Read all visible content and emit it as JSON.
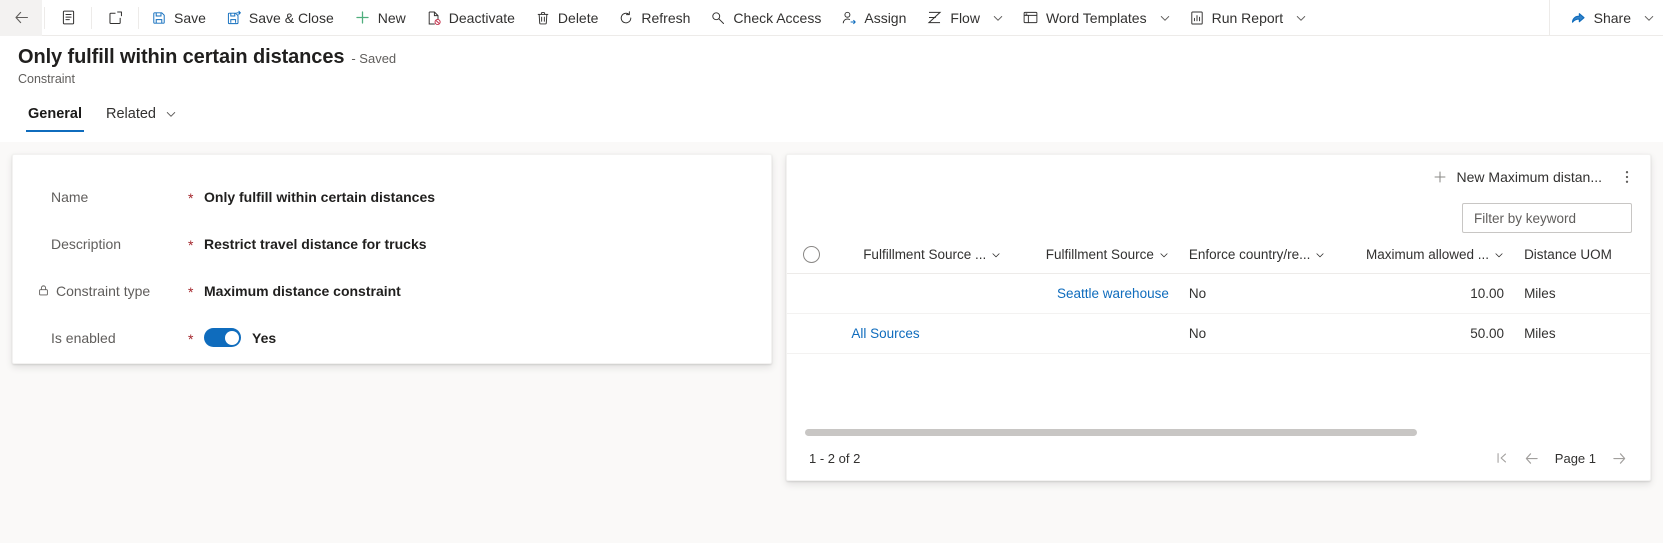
{
  "commandbar": {
    "back_icon": "back-arrow-icon",
    "form_selector_icon": "form-selector-icon",
    "popout_icon": "open-in-new-window-icon",
    "buttons": [
      {
        "label": "Save",
        "icon": "save-icon"
      },
      {
        "label": "Save & Close",
        "icon": "save-and-close-icon"
      },
      {
        "label": "New",
        "icon": "plus-icon"
      },
      {
        "label": "Deactivate",
        "icon": "deactivate-icon"
      },
      {
        "label": "Delete",
        "icon": "trash-icon"
      },
      {
        "label": "Refresh",
        "icon": "refresh-icon"
      },
      {
        "label": "Check Access",
        "icon": "key-icon"
      },
      {
        "label": "Assign",
        "icon": "assign-person-icon"
      },
      {
        "label": "Flow",
        "icon": "flow-icon",
        "chevron": true
      },
      {
        "label": "Word Templates",
        "icon": "word-template-icon",
        "chevron": true
      },
      {
        "label": "Run Report",
        "icon": "report-chart-icon",
        "chevron": true
      }
    ],
    "share": {
      "label": "Share",
      "icon": "share-icon",
      "chevron": true
    }
  },
  "header": {
    "title": "Only fulfill within certain distances",
    "saved_status": "- Saved",
    "entity": "Constraint",
    "tabs": [
      {
        "label": "General",
        "active": true,
        "chevron": false
      },
      {
        "label": "Related",
        "active": false,
        "chevron": true
      }
    ]
  },
  "form": {
    "fields": [
      {
        "label": "Name",
        "required": "*",
        "value": "Only fulfill within certain distances",
        "locked": false,
        "type": "text"
      },
      {
        "label": "Description",
        "required": "*",
        "value": "Restrict travel distance for trucks",
        "locked": false,
        "type": "text"
      },
      {
        "label": "Constraint type",
        "required": "*",
        "value": "Maximum distance constraint",
        "locked": true,
        "lock_icon": "lock-icon",
        "type": "text"
      },
      {
        "label": "Is enabled",
        "required": "*",
        "value": "Yes",
        "locked": false,
        "type": "toggle",
        "toggle_on": true
      }
    ]
  },
  "subgrid": {
    "new_button": {
      "label": "New Maximum distan...",
      "icon": "plus-icon"
    },
    "more_icon": "more-vertical-icon",
    "filter": {
      "placeholder": "Filter by keyword",
      "value": ""
    },
    "select_all_icon": "select-all-circle-icon",
    "columns": [
      {
        "label": "Fulfillment Source ...",
        "chevron": true,
        "align": "right"
      },
      {
        "label": "Fulfillment Source",
        "chevron": true,
        "align": "right"
      },
      {
        "label": "Enforce country/re...",
        "chevron": true,
        "align": "left"
      },
      {
        "label": "Maximum allowed ...",
        "chevron": true,
        "align": "right"
      },
      {
        "label": "Distance UOM",
        "chevron": false,
        "align": "left"
      }
    ],
    "rows": [
      {
        "c1": "",
        "c2": "Seattle warehouse",
        "c2_link": true,
        "c3": "No",
        "c4": "10.00",
        "c5": "Miles"
      },
      {
        "c1": "All Sources",
        "c1_link": true,
        "c2": "",
        "c3": "No",
        "c4": "50.00",
        "c5": "Miles"
      }
    ],
    "footer": {
      "count": "1 - 2 of 2",
      "page_label": "Page 1",
      "first_icon": "first-page-icon",
      "prev_icon": "previous-page-icon",
      "next_icon": "next-page-icon"
    }
  },
  "colors": {
    "accent": "#0f6cbd",
    "required": "#a4262c",
    "toggle_on": "#0f6cbd",
    "link": "#0f6cbd",
    "body_bg": "#faf9f8"
  }
}
